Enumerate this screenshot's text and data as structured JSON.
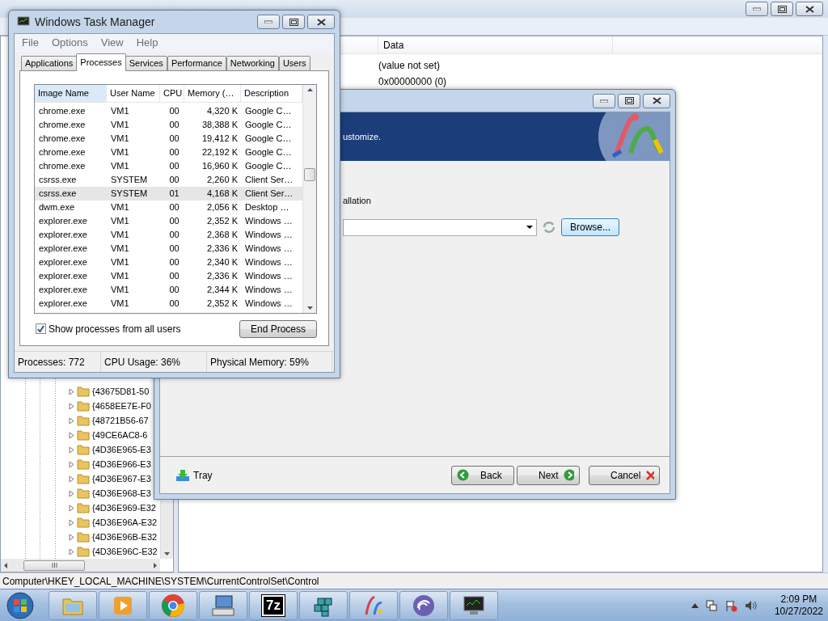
{
  "registry_editor": {
    "columns": [
      {
        "label": "Data"
      }
    ],
    "values": [
      {
        "data": "(value not set)"
      },
      {
        "data": "0x00000000 (0)"
      }
    ],
    "tree_items": [
      "{43675D81-50",
      "{4658EE7E-F0",
      "{48721B56-67",
      "{49CE6AC8-6",
      "{4D36E965-E3",
      "{4D36E966-E3",
      "{4D36E967-E3",
      "{4D36E968-E3",
      "{4D36E969-E32",
      "{4D36E96A-E32",
      "{4D36E96B-E32",
      "{4D36E96C-E32"
    ],
    "status_bar": "Computer\\HKEY_LOCAL_MACHINE\\SYSTEM\\CurrentControlSet\\Control"
  },
  "task_manager": {
    "title": "Windows Task Manager",
    "menu": [
      "File",
      "Options",
      "View",
      "Help"
    ],
    "tabs": [
      {
        "label": "Applications",
        "selected": false
      },
      {
        "label": "Processes",
        "selected": true
      },
      {
        "label": "Services",
        "selected": false
      },
      {
        "label": "Performance",
        "selected": false
      },
      {
        "label": "Networking",
        "selected": false
      },
      {
        "label": "Users",
        "selected": false
      }
    ],
    "columns": [
      "Image Name",
      "User Name",
      "CPU",
      "Memory (…",
      "Description"
    ],
    "rows": [
      {
        "cells": [
          "chrome.exe",
          "VM1",
          "00",
          "4,320 K",
          "Google C…"
        ],
        "selected": false
      },
      {
        "cells": [
          "chrome.exe",
          "VM1",
          "00",
          "38,388 K",
          "Google C…"
        ],
        "selected": false
      },
      {
        "cells": [
          "chrome.exe",
          "VM1",
          "00",
          "19,412 K",
          "Google C…"
        ],
        "selected": false
      },
      {
        "cells": [
          "chrome.exe",
          "VM1",
          "00",
          "22,192 K",
          "Google C…"
        ],
        "selected": false
      },
      {
        "cells": [
          "chrome.exe",
          "VM1",
          "00",
          "16,960 K",
          "Google C…"
        ],
        "selected": false
      },
      {
        "cells": [
          "csrss.exe",
          "SYSTEM",
          "00",
          "2,260 K",
          "Client Ser…"
        ],
        "selected": false
      },
      {
        "cells": [
          "csrss.exe",
          "SYSTEM",
          "01",
          "4,168 K",
          "Client Ser…"
        ],
        "selected": true
      },
      {
        "cells": [
          "dwm.exe",
          "VM1",
          "00",
          "2,056 K",
          "Desktop …"
        ],
        "selected": false
      },
      {
        "cells": [
          "explorer.exe",
          "VM1",
          "00",
          "2,352 K",
          "Windows …"
        ],
        "selected": false
      },
      {
        "cells": [
          "explorer.exe",
          "VM1",
          "00",
          "2,368 K",
          "Windows …"
        ],
        "selected": false
      },
      {
        "cells": [
          "explorer.exe",
          "VM1",
          "00",
          "2,336 K",
          "Windows …"
        ],
        "selected": false
      },
      {
        "cells": [
          "explorer.exe",
          "VM1",
          "00",
          "2,340 K",
          "Windows …"
        ],
        "selected": false
      },
      {
        "cells": [
          "explorer.exe",
          "VM1",
          "00",
          "2,336 K",
          "Windows …"
        ],
        "selected": false
      },
      {
        "cells": [
          "explorer.exe",
          "VM1",
          "00",
          "2,344 K",
          "Windows …"
        ],
        "selected": false
      },
      {
        "cells": [
          "explorer.exe",
          "VM1",
          "00",
          "2,352 K",
          "Windows …"
        ],
        "selected": false
      }
    ],
    "show_all_users": {
      "label": "Show processes from all users",
      "checked": true
    },
    "end_process": "End Process",
    "status": [
      "Processes: 772",
      "CPU Usage: 36%",
      "Physical Memory: 59%"
    ]
  },
  "installer": {
    "banner_text": "ustomize.",
    "option_text": "allation",
    "browse": "Browse...",
    "tray": "Tray",
    "buttons": [
      {
        "label": "Back",
        "kind": "back"
      },
      {
        "label": "Next",
        "kind": "next"
      },
      {
        "label": "Cancel",
        "kind": "cancel"
      }
    ]
  },
  "taskbar": {
    "apps": [
      {
        "kind": "folder"
      },
      {
        "kind": "media"
      },
      {
        "kind": "browser"
      },
      {
        "kind": "keyboard"
      },
      {
        "kind": "archive",
        "label": "7z"
      },
      {
        "kind": "cubes"
      },
      {
        "kind": "installer"
      },
      {
        "kind": "torrent"
      },
      {
        "kind": "monitor"
      }
    ],
    "time": "2:09 PM",
    "date": "10/27/2022"
  }
}
